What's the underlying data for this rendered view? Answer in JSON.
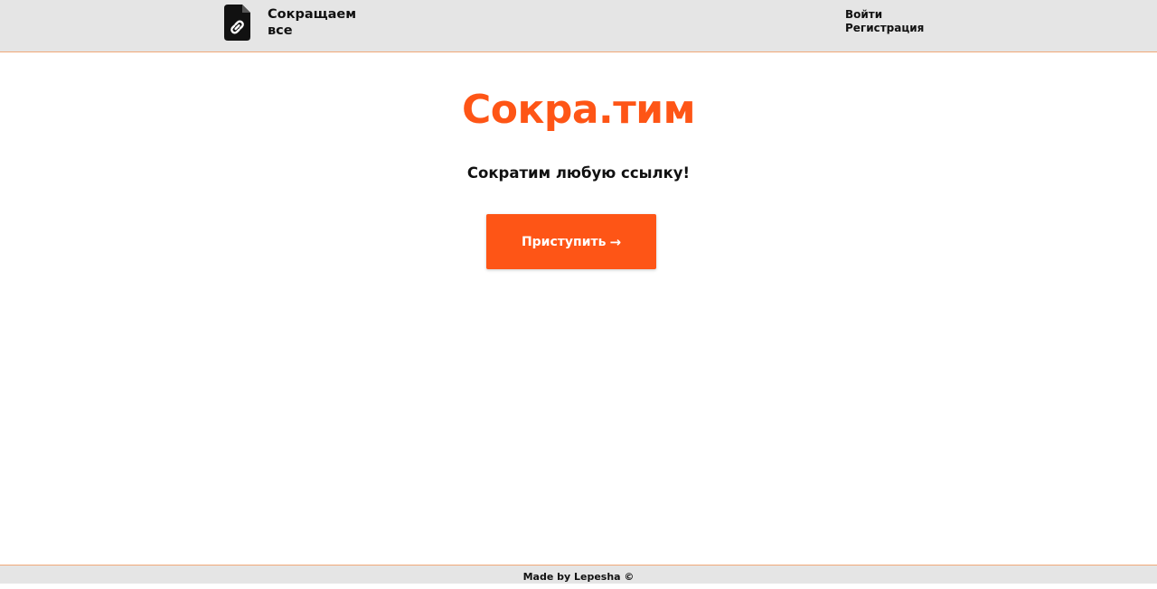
{
  "header": {
    "brand_text": "Сокращаем все",
    "logo_icon": "file-link-icon",
    "nav": {
      "login": "Войти",
      "register": "Регистрация"
    }
  },
  "hero": {
    "title": "Сокра.тим",
    "subtitle": "Сократим любую ссылку!",
    "cta_label": "Приступить",
    "cta_arrow": "→"
  },
  "footer": {
    "credit": "Made by Lepesha ©"
  },
  "colors": {
    "accent": "#fe5516",
    "bar_background": "#e5e5e5",
    "bar_border": "#f0a878",
    "text": "#111111"
  }
}
